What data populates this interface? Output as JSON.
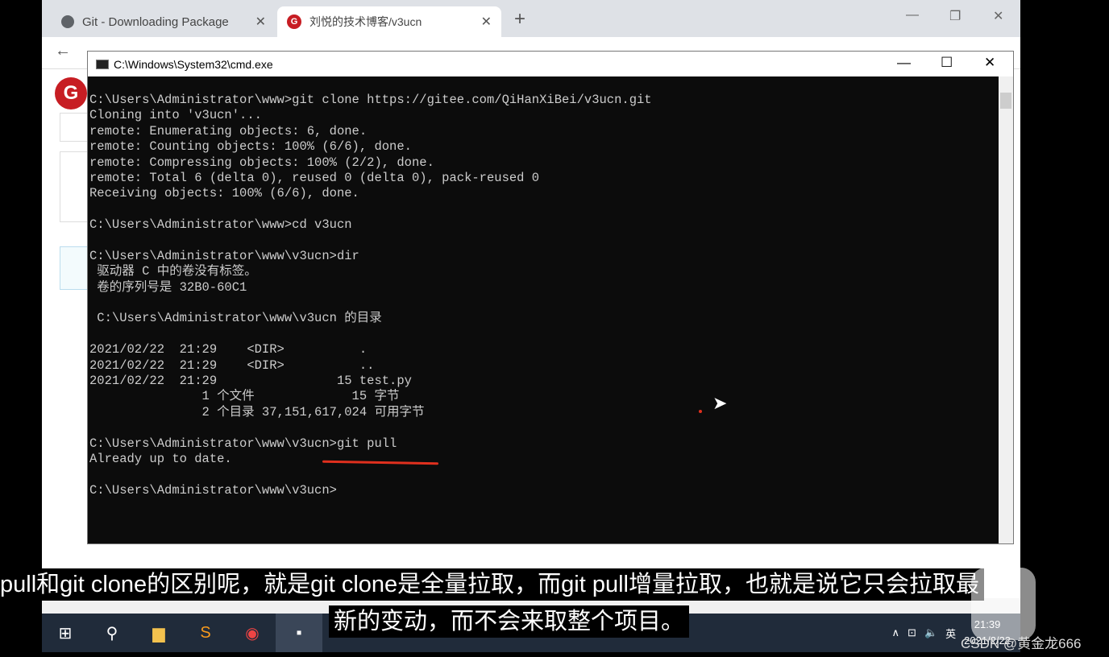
{
  "browser": {
    "tabs": [
      {
        "label": "Git - Downloading Package",
        "icon": "globe-icon"
      },
      {
        "label": "刘悦的技术博客/v3ucn",
        "icon": "gitee-icon",
        "active": true
      }
    ],
    "logo_letter": "G"
  },
  "cmd": {
    "title": "C:\\Windows\\System32\\cmd.exe",
    "lines": [
      "C:\\Users\\Administrator\\www>git clone https://gitee.com/QiHanXiBei/v3ucn.git",
      "Cloning into 'v3ucn'...",
      "remote: Enumerating objects: 6, done.",
      "remote: Counting objects: 100% (6/6), done.",
      "remote: Compressing objects: 100% (2/2), done.",
      "remote: Total 6 (delta 0), reused 0 (delta 0), pack-reused 0",
      "Receiving objects: 100% (6/6), done.",
      "",
      "C:\\Users\\Administrator\\www>cd v3ucn",
      "",
      "C:\\Users\\Administrator\\www\\v3ucn>dir",
      " 驱动器 C 中的卷没有标签。",
      " 卷的序列号是 32B0-60C1",
      "",
      " C:\\Users\\Administrator\\www\\v3ucn 的目录",
      "",
      "2021/02/22  21:29    <DIR>          .",
      "2021/02/22  21:29    <DIR>          ..",
      "2021/02/22  21:29                15 test.py",
      "               1 个文件             15 字节",
      "               2 个目录 37,151,617,024 可用字节",
      "",
      "C:\\Users\\Administrator\\www\\v3ucn>git pull",
      "Already up to date.",
      "",
      "C:\\Users\\Administrator\\www\\v3ucn>"
    ]
  },
  "subtitles": {
    "line1": "pull和git clone的区别呢，就是git clone是全量拉取，而git pull增量拉取，也就是说它只会拉取最",
    "line2": "新的变动，而不会来取整个项目。"
  },
  "taskbar": {
    "time": "21:39",
    "date": "2021/2/22",
    "ime": "英"
  },
  "watermark": "CSDN @黄金龙666",
  "colors": {
    "annotation": "#e0301e",
    "terminal_bg": "#0c0c0c"
  }
}
